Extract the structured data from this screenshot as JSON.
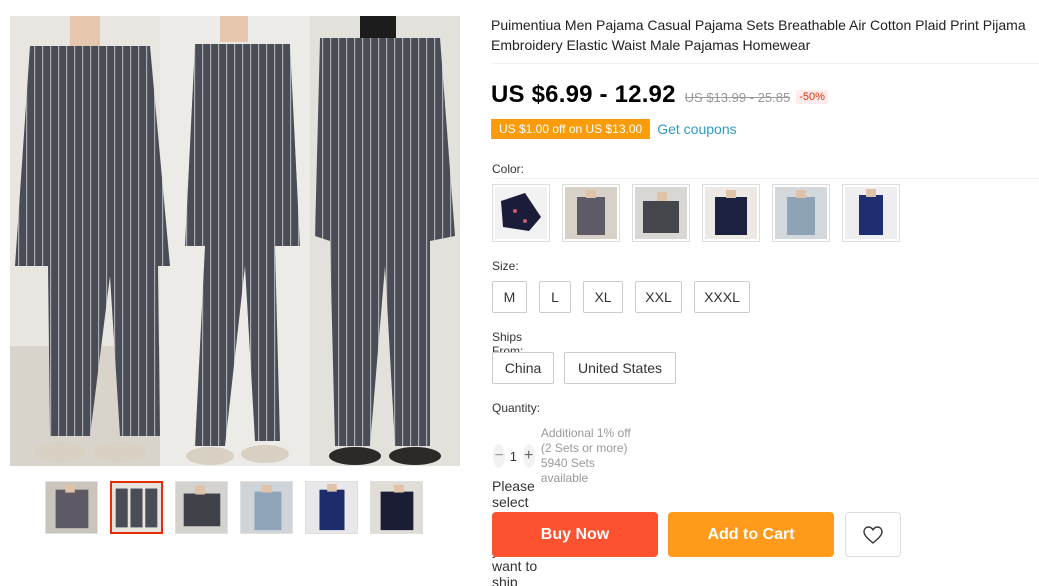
{
  "product": {
    "title": "Puimentiua Men Pajama Casual Pajama Sets Breathable Air Cotton Plaid Print Pijama Embroidery Elastic Waist Male Pajamas Homewear",
    "price": "US $6.99 - 12.92",
    "original_price": "US $13.99 - 25.85",
    "discount": "-50%",
    "coupon_text": "US $1.00 off on US $13.00",
    "get_coupons": "Get coupons"
  },
  "gallery": {
    "thumbnails": [
      "thumb-grey-plaid",
      "thumb-grey-stripe-selected",
      "thumb-dark-grey",
      "thumb-light-blue",
      "thumb-navy-print",
      "thumb-navy-dark"
    ],
    "active_index": 1
  },
  "color": {
    "label": "Color:",
    "options": [
      "navy-print",
      "grey-plaid",
      "dark-grey",
      "navy",
      "light-blue",
      "navy-pattern"
    ]
  },
  "size": {
    "label": "Size:",
    "options": [
      "M",
      "L",
      "XL",
      "XXL",
      "XXXL"
    ]
  },
  "ships_from": {
    "label": "Ships From:",
    "options": [
      "China",
      "United States"
    ]
  },
  "quantity": {
    "label": "Quantity:",
    "minus": "−",
    "value": "1",
    "plus": "+",
    "note_line1": "Additional 1% off (2 Sets or more)",
    "note_line2": "5940 Sets available"
  },
  "ship_prompt": "Please select the country you want to ship from",
  "actions": {
    "buy_now": "Buy Now",
    "add_to_cart": "Add to Cart",
    "wishlist_icon": "heart-icon"
  },
  "colors": {
    "accent_red": "#e62e04",
    "buy_now": "#fd5230",
    "add_to_cart": "#ff9a1a",
    "coupon": "#fa9c0a",
    "link": "#2e9cc3"
  }
}
